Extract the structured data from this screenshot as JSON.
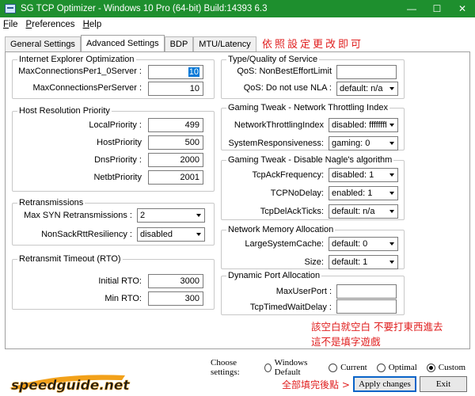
{
  "window": {
    "title": "SG TCP Optimizer - Windows 10 Pro (64-bit) Build:14393 6.3",
    "controls": [
      "—",
      "☐",
      "✕"
    ]
  },
  "menu": [
    {
      "label": "File",
      "mnemonic": "F",
      "rest": "ile"
    },
    {
      "label": "Preferences",
      "mnemonic": "P",
      "rest": "references"
    },
    {
      "label": "Help",
      "mnemonic": "H",
      "rest": "elp"
    }
  ],
  "tabs": [
    "General Settings",
    "Advanced Settings",
    "BDP",
    "MTU/Latency"
  ],
  "tab_note": "依照設定更改即可",
  "ie": {
    "legend": "Internet Explorer Optimization",
    "rows": [
      {
        "label": "MaxConnectionsPer1_0Server :",
        "value": "10"
      },
      {
        "label": "MaxConnectionsPerServer :",
        "value": "10"
      }
    ]
  },
  "hostres": {
    "legend": "Host Resolution Priority",
    "rows": [
      {
        "label": "LocalPriority :",
        "value": "499"
      },
      {
        "label": "HostPriority",
        "value": "500"
      },
      {
        "label": "DnsPriority :",
        "value": "2000"
      },
      {
        "label": "NetbtPriority",
        "value": "2001"
      }
    ]
  },
  "retrans": {
    "legend": "Retransmissions",
    "rows": [
      {
        "label": "Max SYN Retransmissions :",
        "value": "2"
      },
      {
        "label": "NonSackRttResiliency :",
        "value": "disabled"
      }
    ]
  },
  "rto": {
    "legend": "Retransmit Timeout (RTO)",
    "rows": [
      {
        "label": "Initial RTO:",
        "value": "3000"
      },
      {
        "label": "Min RTO:",
        "value": "300"
      }
    ]
  },
  "tos": {
    "legend": "Type/Quality of Service",
    "rows": [
      {
        "label": "QoS: NonBestEffortLimit",
        "value": ""
      },
      {
        "label": "QoS: Do not use NLA :",
        "value": "default: n/a"
      }
    ]
  },
  "gaming_throttle": {
    "legend": "Gaming Tweak - Network Throttling Index",
    "rows": [
      {
        "label": "NetworkThrottlingIndex",
        "value": "disabled: ffffffff"
      },
      {
        "label": "SystemResponsiveness:",
        "value": "gaming: 0"
      }
    ]
  },
  "gaming_nagle": {
    "legend": "Gaming Tweak - Disable Nagle's algorithm",
    "rows": [
      {
        "label": "TcpAckFrequency:",
        "value": "disabled: 1"
      },
      {
        "label": "TCPNoDelay:",
        "value": "enabled: 1"
      },
      {
        "label": "TcpDelAckTicks:",
        "value": "default: n/a"
      }
    ]
  },
  "netmem": {
    "legend": "Network Memory Allocation",
    "rows": [
      {
        "label": "LargeSystemCache:",
        "value": "default: 0"
      },
      {
        "label": "Size:",
        "value": "default: 1"
      }
    ]
  },
  "dynport": {
    "legend": "Dynamic Port Allocation",
    "rows": [
      {
        "label": "MaxUserPort :",
        "value": ""
      },
      {
        "label": "TcpTimedWaitDelay :",
        "value": ""
      }
    ]
  },
  "blank_note": [
    "該空白就空白 不要打東西進去",
    "這不是填字遊戲"
  ],
  "bottom": {
    "choose_label": "Choose settings:",
    "radios": [
      {
        "label": "Windows Default",
        "checked": false
      },
      {
        "label": "Current",
        "checked": false
      },
      {
        "label": "Optimal",
        "checked": false
      },
      {
        "label": "Custom",
        "checked": true
      }
    ],
    "apply_note": "全部填完後點 >",
    "apply_label": "Apply changes",
    "exit_label": "Exit",
    "logo_text": "speedguide.net"
  },
  "colors": {
    "titlebar": "#1e8f2e",
    "note_red": "#e02020",
    "selection_blue": "#0078d7",
    "logo_orange": "#f2a11a",
    "logo_black": "#1a1a1a"
  }
}
